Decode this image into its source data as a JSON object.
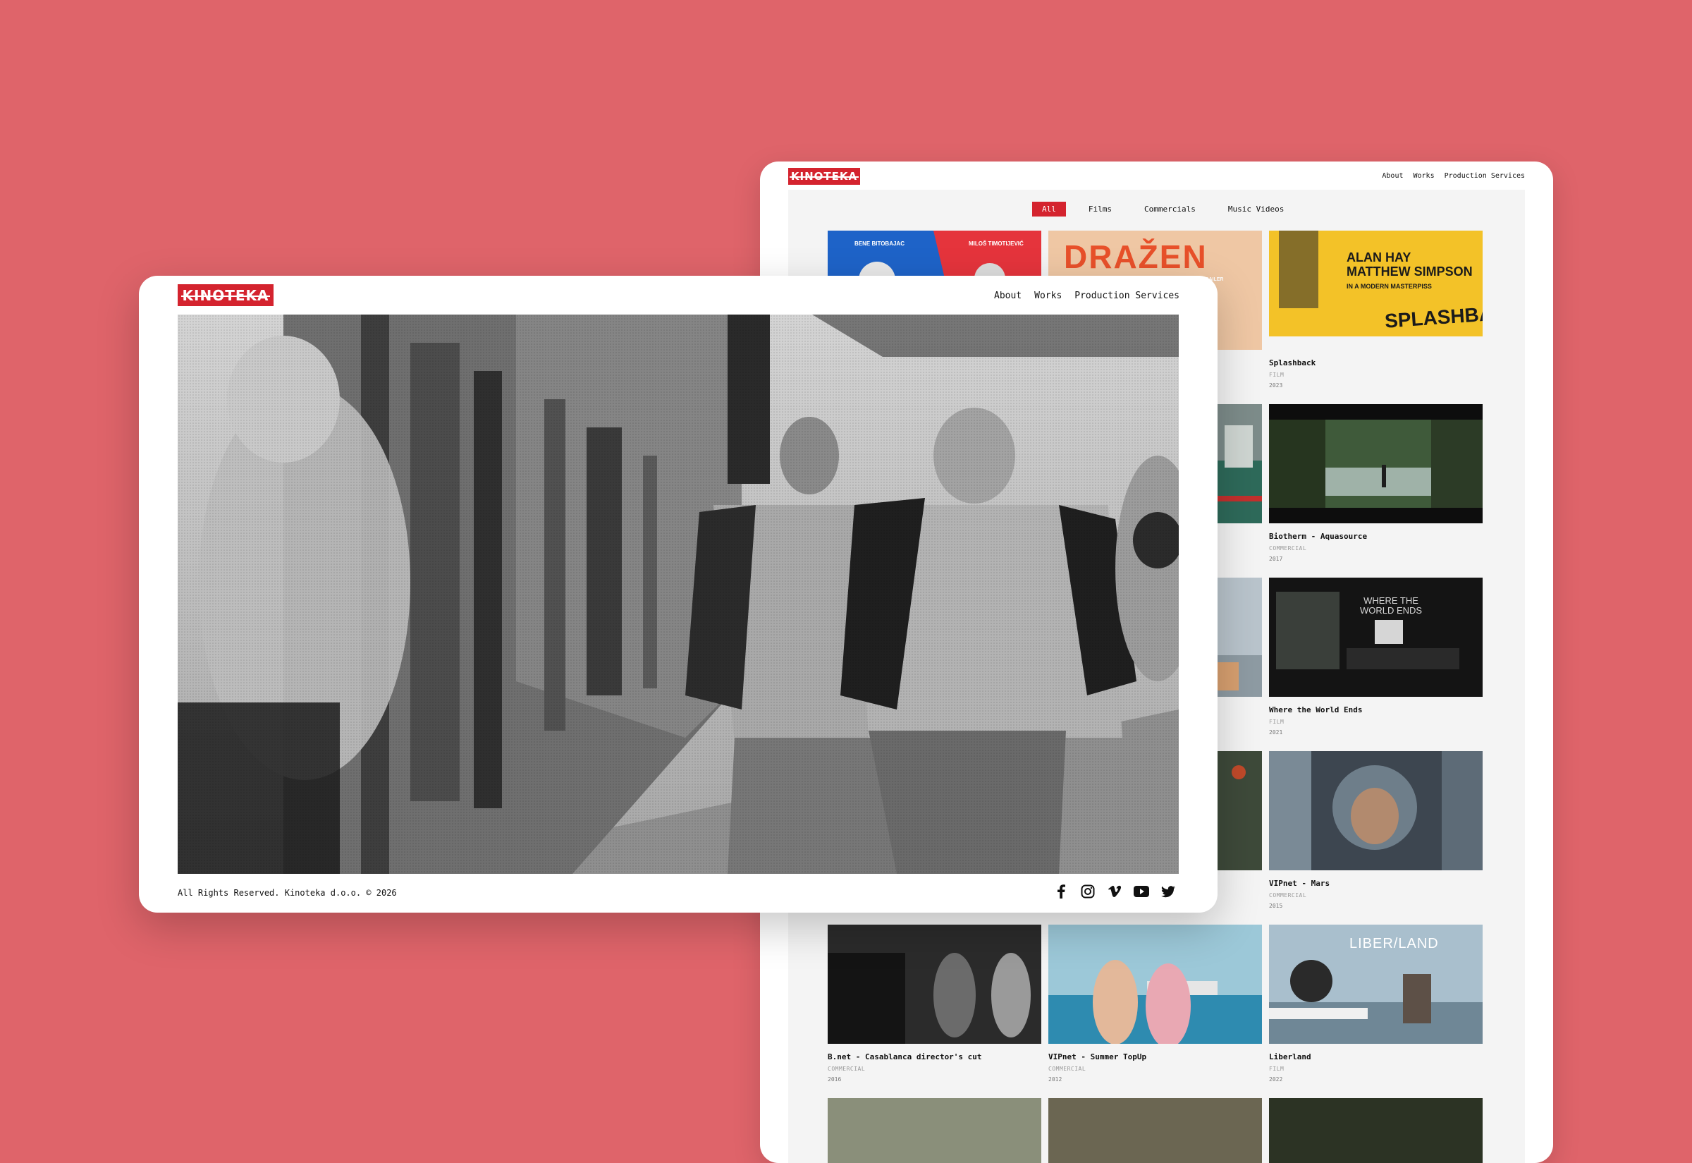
{
  "brand": {
    "logo_text": "KINOTEKA",
    "accent": "#D4232E",
    "background": "#DF646A"
  },
  "nav": {
    "about": "About",
    "works": "Works",
    "production": "Production Services"
  },
  "filters": [
    {
      "label": "All",
      "active": true
    },
    {
      "label": "Films",
      "active": false
    },
    {
      "label": "Commercials",
      "active": false
    },
    {
      "label": "Music Videos",
      "active": false
    }
  ],
  "works": [
    {
      "title": "Splashback",
      "type": "FILM",
      "year": "2023"
    },
    {
      "title": "Biotherm - Aquasource",
      "type": "COMMERCIAL",
      "year": "2017"
    },
    {
      "title": "Where the World Ends",
      "type": "FILM",
      "year": "2021"
    },
    {
      "title": "VIPnet - Mars",
      "type": "COMMERCIAL",
      "year": "2015"
    },
    {
      "title": "B.net - Casablanca director's cut",
      "type": "COMMERCIAL",
      "year": "2016"
    },
    {
      "title": "VIPnet - Summer TopUp",
      "type": "COMMERCIAL",
      "year": "2012"
    },
    {
      "title": "Liberland",
      "type": "FILM",
      "year": "2022"
    }
  ],
  "posters": {
    "poster1_names": [
      "BENE BITOBAJAC",
      "MILOŠ TIMOTIJEVIĆ"
    ],
    "drazen_title": "DRAŽEN",
    "drazen_sub": "CIAL TRAILER",
    "splashback_cast": "ALAN HAY\nMATTHEW SIMPSON",
    "splashback_tagline": "IN A MODERN MASTERPISS",
    "splashback_title": "SPLASHBACK",
    "wwe_title": "WHERE THE WORLD ENDS",
    "liberland_title": "LIBER/LAND"
  },
  "footer": {
    "copyright": "All Rights Reserved. Kinoteka d.o.o. © 2026"
  },
  "social": [
    "facebook-icon",
    "instagram-icon",
    "vimeo-icon",
    "youtube-icon",
    "twitter-icon"
  ]
}
